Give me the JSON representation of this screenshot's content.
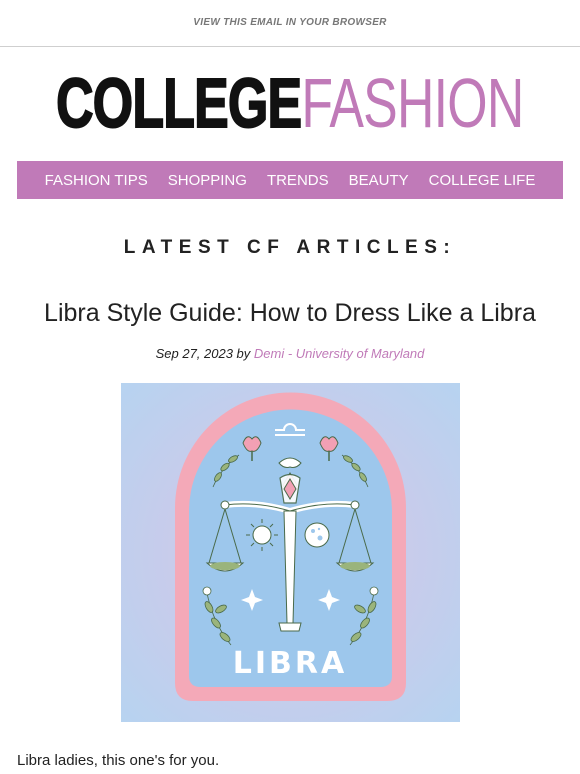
{
  "header": {
    "view_in_browser": "VIEW THIS EMAIL IN YOUR BROWSER"
  },
  "logo": {
    "part1": "COLLEGE",
    "part2": "FASHION"
  },
  "nav": {
    "items": [
      "FASHION TIPS",
      "SHOPPING",
      "TRENDS",
      "BEAUTY",
      "COLLEGE LIFE"
    ]
  },
  "section": {
    "title": "LATEST CF ARTICLES:"
  },
  "article": {
    "title": "Libra Style Guide: How to Dress Like a Libra",
    "date_prefix": "Sep 27, 2023 by ",
    "author": "Demi - University of Maryland",
    "image_text": "LIBRA",
    "intro": "Libra ladies, this one's for you."
  },
  "colors": {
    "brand_pink": "#c07ab8",
    "image_bg": "#bcd2ef",
    "badge_pink": "#f4a9b8",
    "badge_blue": "#9dc7ec",
    "leaf_green": "#9ab47c"
  }
}
